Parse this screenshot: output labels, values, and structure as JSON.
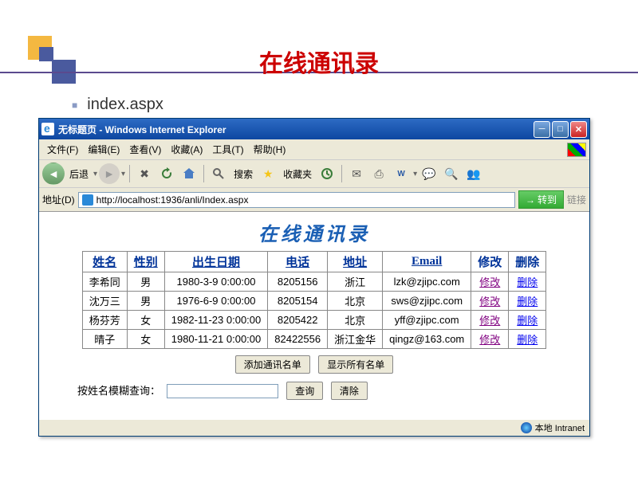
{
  "slide": {
    "title": "在线通讯录",
    "bullet": "index.aspx"
  },
  "ie": {
    "title": "无标题页 - Windows Internet Explorer",
    "menus": [
      "文件(F)",
      "编辑(E)",
      "查看(V)",
      "收藏(A)",
      "工具(T)",
      "帮助(H)"
    ],
    "back_label": "后退",
    "search_label": "搜索",
    "fav_label": "收藏夹",
    "addr_label": "地址(D)",
    "url": "http://localhost:1936/anli/Index.aspx",
    "go_label": "转到",
    "links_label": "链接",
    "status": "本地 Intranet"
  },
  "page": {
    "title": "在线通讯录",
    "headers": [
      "姓名",
      "性别",
      "出生日期",
      "电话",
      "地址",
      "Email",
      "修改",
      "删除"
    ],
    "rows": [
      {
        "name": "李希同",
        "gender": "男",
        "dob": "1980-3-9 0:00:00",
        "tel": "8205156",
        "addr": "浙江",
        "email": "lzk@zjipc.com"
      },
      {
        "name": "沈万三",
        "gender": "男",
        "dob": "1976-6-9 0:00:00",
        "tel": "8205154",
        "addr": "北京",
        "email": "sws@zjipc.com"
      },
      {
        "name": "杨芬芳",
        "gender": "女",
        "dob": "1982-11-23 0:00:00",
        "tel": "8205422",
        "addr": "北京",
        "email": "yff@zjipc.com"
      },
      {
        "name": "晴子",
        "gender": "女",
        "dob": "1980-11-21 0:00:00",
        "tel": "82422556",
        "addr": "浙江金华",
        "email": "qingz@163.com"
      }
    ],
    "edit_label": "修改",
    "del_label": "删除",
    "add_btn": "添加通讯名单",
    "showall_btn": "显示所有名单",
    "search_label": "按姓名模糊查询：",
    "search_btn": "查询",
    "clear_btn": "清除"
  }
}
